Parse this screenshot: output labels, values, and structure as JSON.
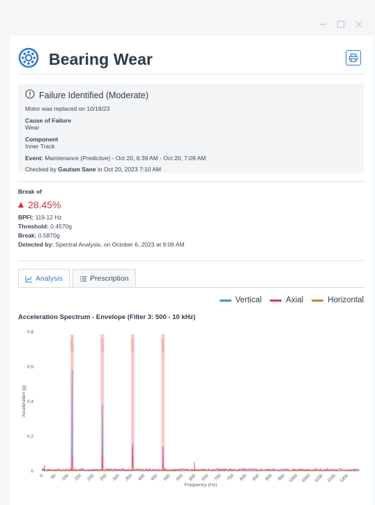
{
  "title": "Bearing Wear",
  "failure": {
    "heading": "Failure Identified (Moderate)",
    "note": "Motor was replaced on 10/18/23",
    "cause_label": "Cause of Failure",
    "cause_value": "Wear",
    "component_label": "Component",
    "component_value": "Inner Track",
    "event_label": "Event:",
    "event_value": " Maintenance (Predictive) - Oct 20, 6:39 AM - Oct 20, 7:09 AM",
    "checked_prefix": "Checked by ",
    "checked_user": "Gautam Sane",
    "checked_suffix": " in Oct 20, 2023 7:10 AM"
  },
  "break": {
    "label": "Break of",
    "percent": "28.45%",
    "bpfi_label": "BPFI:",
    "bpfi_value": " 119.12 Hz",
    "threshold_label": "Threshold:",
    "threshold_value": " 0.4570g",
    "break_label": "Break:",
    "break_value": " 0.5870g",
    "detected_label": "Detected by:",
    "detected_value": " Spectral Analysis, on October 6, 2023 at 9:06 AM"
  },
  "tabs": [
    {
      "label": "Analysis",
      "icon": "line-chart-icon",
      "active": true
    },
    {
      "label": "Prescription",
      "icon": "list-icon",
      "active": false
    }
  ],
  "legend": [
    {
      "name": "Vertical",
      "color": "#4a8fd8"
    },
    {
      "name": "Axial",
      "color": "#d6337a"
    },
    {
      "name": "Horizontal",
      "color": "#c8862a"
    }
  ],
  "chart_data": {
    "type": "line",
    "title": "Acceleration Spectrum - Envelope (Filter 3: 500 - 10 kHz)",
    "xlabel": "Frequency (Hz)",
    "ylabel": "Acceleration (g)",
    "xlim": [
      0,
      1250
    ],
    "ylim": [
      0,
      0.8
    ],
    "x_ticks": [
      0,
      50,
      100,
      150,
      200,
      250,
      300,
      350,
      400,
      450,
      500,
      550,
      600,
      650,
      700,
      750,
      800,
      850,
      900,
      950,
      1000,
      1050,
      1100,
      1150,
      1200
    ],
    "y_ticks": [
      0,
      0.2,
      0.4,
      0.6,
      0.8
    ],
    "markers": [
      {
        "label": "1xBPFI",
        "x": 119.12
      },
      {
        "label": "2xBPFI",
        "x": 238.24
      },
      {
        "label": "3xBPFI",
        "x": 357.36
      },
      {
        "label": "4xBPFI",
        "x": 476.48
      }
    ],
    "series": [
      {
        "name": "Vertical",
        "color": "#4a8fd8",
        "peaks": [
          [
            10,
            0.03
          ],
          [
            119.12,
            0.58
          ],
          [
            238.24,
            0.38
          ],
          [
            357.36,
            0.16
          ],
          [
            476.48,
            0.04
          ]
        ]
      },
      {
        "name": "Axial",
        "color": "#d6337a",
        "peaks": [
          [
            10,
            0.03
          ],
          [
            119.12,
            0.08
          ],
          [
            238.24,
            0.09
          ],
          [
            357.36,
            0.14
          ],
          [
            476.48,
            0.14
          ],
          [
            600,
            0.05
          ]
        ]
      },
      {
        "name": "Horizontal",
        "color": "#c8862a",
        "peaks": [
          [
            10,
            0.02
          ],
          [
            119.12,
            0.03
          ],
          [
            238.24,
            0.02
          ],
          [
            357.36,
            0.03
          ],
          [
            476.48,
            0.02
          ],
          [
            1050,
            0.01
          ]
        ]
      }
    ]
  }
}
